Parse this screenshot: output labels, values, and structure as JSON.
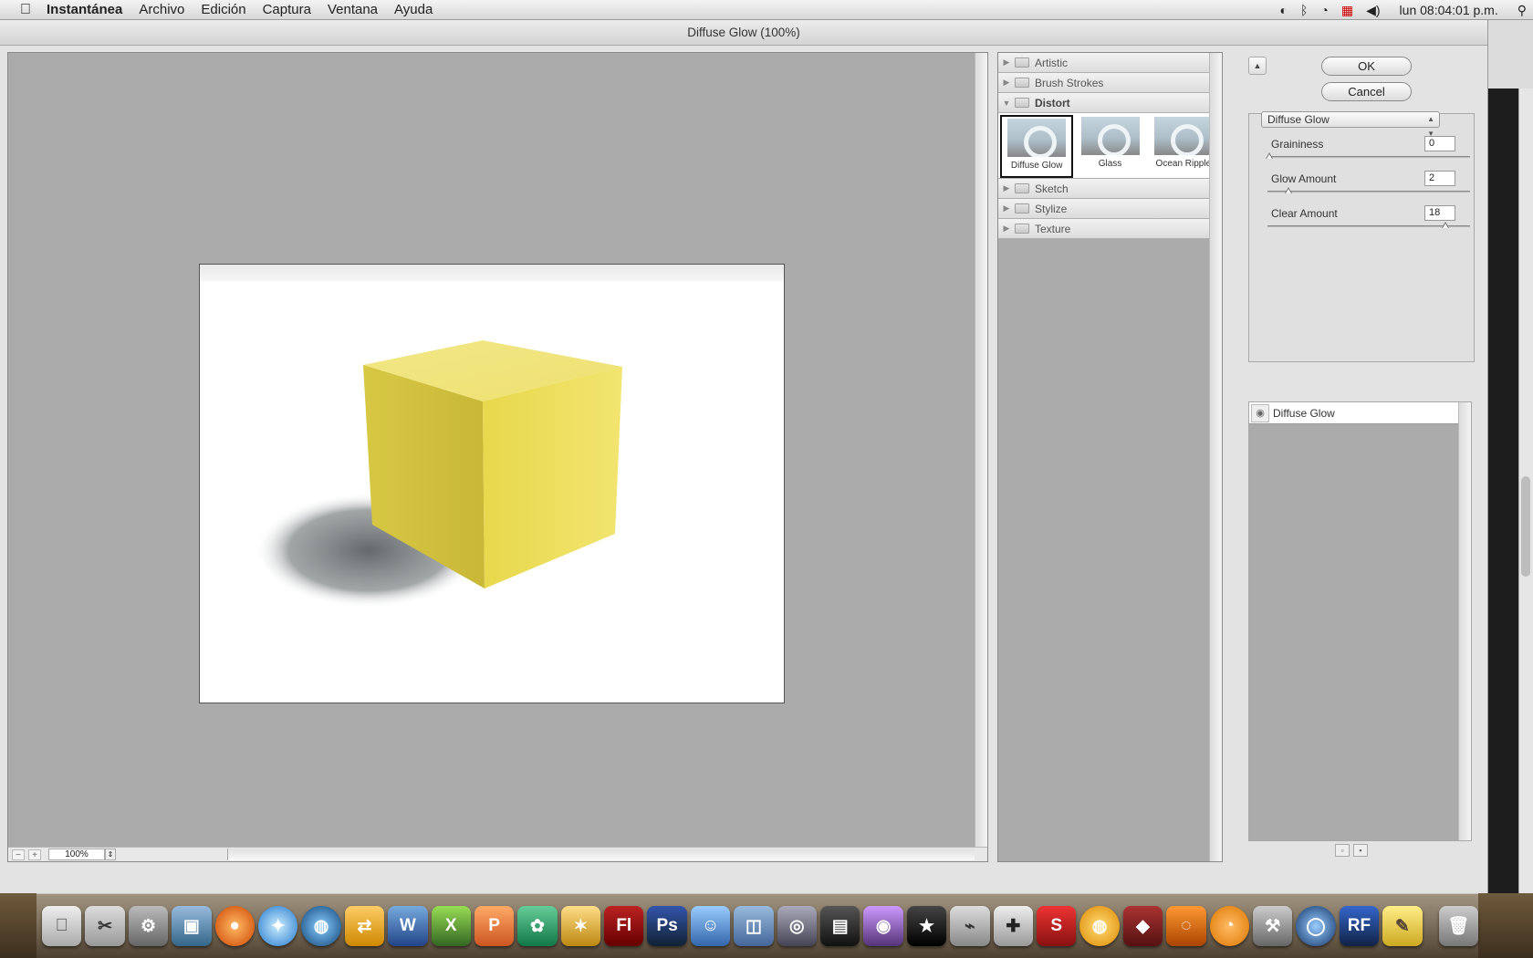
{
  "menubar": {
    "app_name": "Instantánea",
    "menus": [
      "Archivo",
      "Edición",
      "Captura",
      "Ventana",
      "Ayuda"
    ],
    "clock": "lun 08:04:01 p.m."
  },
  "window": {
    "title": "Diffuse Glow (100%)",
    "zoom": "100%"
  },
  "filter_categories": {
    "artistic": "Artistic",
    "brush_strokes": "Brush Strokes",
    "distort": "Distort",
    "sketch": "Sketch",
    "stylize": "Stylize",
    "texture": "Texture"
  },
  "distort_filters": [
    "Diffuse Glow",
    "Glass",
    "Ocean Ripple"
  ],
  "buttons": {
    "ok": "OK",
    "cancel": "Cancel"
  },
  "selected_filter": "Diffuse Glow",
  "params": {
    "graininess": {
      "label": "Graininess",
      "value": "0",
      "fraction": 0.0
    },
    "glow_amount": {
      "label": "Glow Amount",
      "value": "2",
      "fraction": 0.1
    },
    "clear_amount": {
      "label": "Clear Amount",
      "value": "18",
      "fraction": 0.9
    }
  },
  "layer": {
    "name": "Diffuse Glow"
  },
  "colors": {
    "cube": "#e8d94a",
    "canvas_bg": "#ababab"
  }
}
